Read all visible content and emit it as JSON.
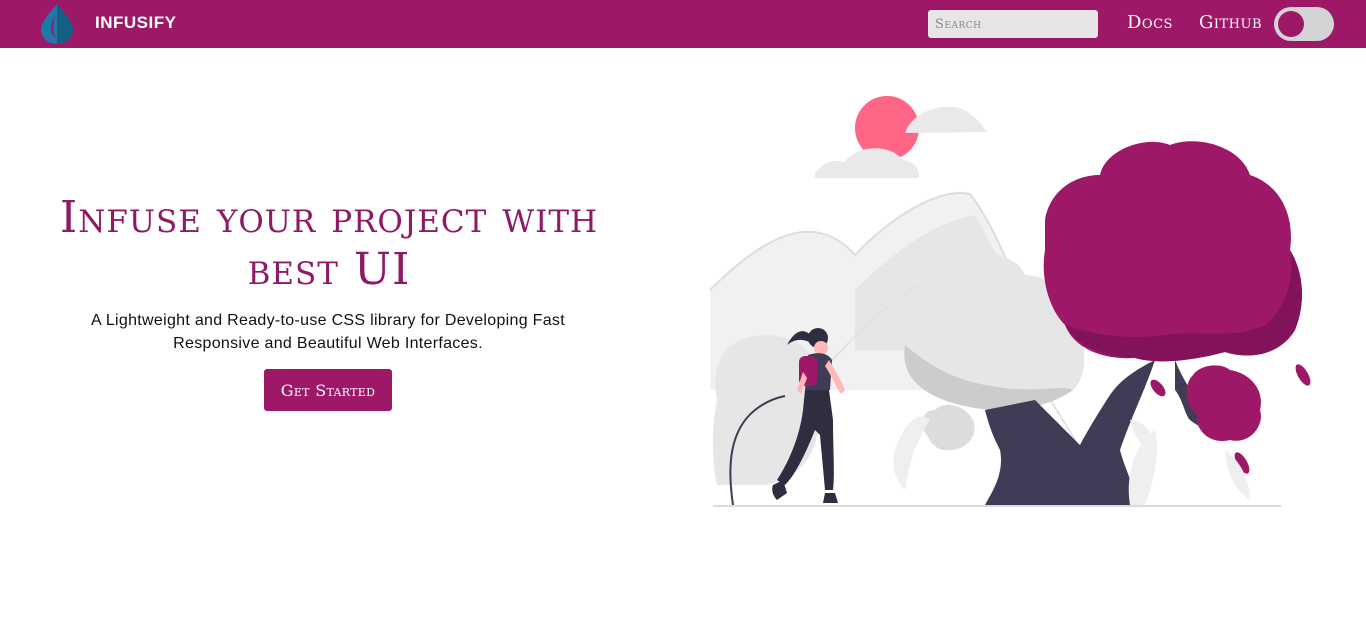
{
  "header": {
    "brand": "INFUSIFY",
    "search_placeholder": "Search",
    "nav": {
      "docs": "Docs",
      "github": "Github"
    }
  },
  "hero": {
    "title": "Infuse your project with best UI",
    "subtitle": "A Lightweight and Ready-to-use CSS library for Developing Fast Responsive and Beautiful Web Interfaces.",
    "cta": "Get Started"
  },
  "colors": {
    "primary": "#9d1867",
    "title": "#8e1a63",
    "logo_blue": "#1d7aa8",
    "sun": "#ff6584",
    "tree_trunk": "#3f3d56"
  },
  "icons": {
    "logo": "water-drop-icon",
    "theme_toggle": "toggle-switch"
  }
}
